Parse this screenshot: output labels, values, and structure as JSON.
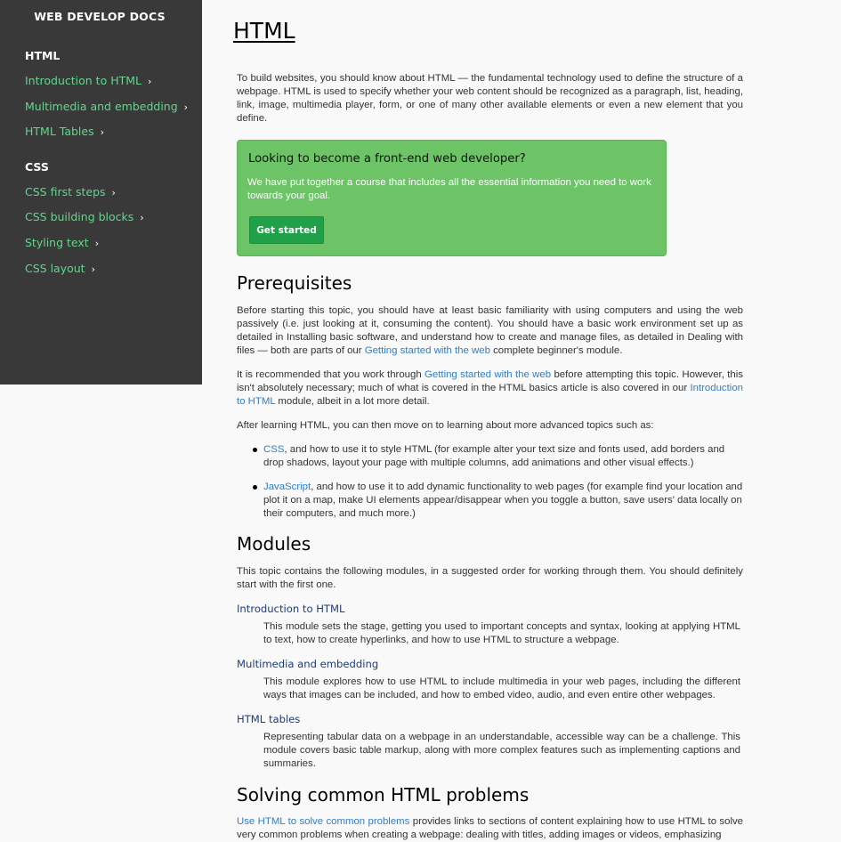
{
  "sidebar": {
    "brand": "WEB DEVELOP DOCS",
    "sections": [
      {
        "title": "HTML",
        "items": [
          {
            "label": "Introduction to HTML",
            "chevron": "›"
          },
          {
            "label": "Multimedia and embedding",
            "chevron": "›"
          },
          {
            "label": "HTML Tables",
            "chevron": "›"
          }
        ]
      },
      {
        "title": "CSS",
        "items": [
          {
            "label": "CSS first steps",
            "chevron": "›"
          },
          {
            "label": "CSS building blocks",
            "chevron": "›"
          },
          {
            "label": "Styling text",
            "chevron": "›"
          },
          {
            "label": "CSS layout",
            "chevron": "›"
          }
        ]
      }
    ]
  },
  "main": {
    "title": "HTML",
    "intro": "To build websites, you should know about HTML — the fundamental technology used to define the structure of a webpage. HTML is used to specify whether your web content should be recognized as a paragraph, list, heading, link, image, multimedia player, form, or one of many other available elements or even a new element that you define.",
    "callout": {
      "title": "Looking to become a front-end web developer?",
      "text": "We have put together a course that includes all the essential information you need to work towards your goal.",
      "button": "Get started"
    },
    "prereq": {
      "heading": "Prerequisites",
      "p1_a": "Before starting this topic, you should have at least basic familiarity with using computers and using the web passively (i.e. just looking at it, consuming the content). You should have a basic work environment set up as detailed in Installing basic software, and understand how to create and manage files, as detailed in Dealing with files — both are parts of our ",
      "p1_link": "Getting started with the web",
      "p1_b": " complete beginner's module.",
      "p2_a": "It is recommended that you work through ",
      "p2_link1": "Getting started with the web",
      "p2_b": " before attempting this topic. However, this isn't absolutely necessary; much of what is covered in the HTML basics article is also covered in our ",
      "p2_link2": "Introduction to HTML",
      "p2_c": " module, albeit in a lot more detail.",
      "p3": "After learning HTML, you can then move on to learning about more advanced topics such as:",
      "list": [
        {
          "link": "CSS",
          "text": ", and how to use it to style HTML (for example alter your text size and fonts used, add borders and drop shadows, layout your page with multiple columns, add animations and other visual effects.)"
        },
        {
          "link": "JavaScript",
          "text": ", and how to use it to add dynamic functionality to web pages (for example find your location and plot it on a map, make UI elements appear/disappear when you toggle a button, save users' data locally on their computers, and much more.)"
        }
      ]
    },
    "modules": {
      "heading": "Modules",
      "intro": "This topic contains the following modules, in a suggested order for working through them. You should definitely start with the first one.",
      "items": [
        {
          "title": "Introduction to HTML",
          "desc": "This module sets the stage, getting you used to important concepts and syntax, looking at applying HTML to text, how to create hyperlinks, and how to use HTML to structure a webpage."
        },
        {
          "title": "Multimedia and embedding",
          "desc": "This module explores how to use HTML to include multimedia in your web pages, including the different ways that images can be included, and how to embed video, audio, and even entire other webpages."
        },
        {
          "title": "HTML tables",
          "desc": "Representing tabular data on a webpage in an understandable, accessible way can be a challenge. This module covers basic table markup, along with more complex features such as implementing captions and summaries."
        }
      ]
    },
    "problems": {
      "heading": "Solving common HTML problems",
      "p_link": "Use HTML to solve common problems",
      "p_text": " provides links to sections of content explaining how to use HTML to solve very common problems when creating a webpage: dealing with titles, adding images or videos, emphasizing"
    }
  }
}
